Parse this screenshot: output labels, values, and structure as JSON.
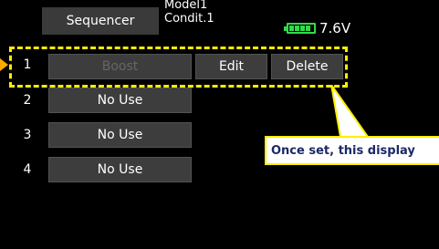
{
  "header": {
    "screen_title": "Sequencer",
    "model_name": "Model1",
    "condition": "Condit.1",
    "battery_voltage": "7.6V"
  },
  "rows": [
    {
      "number": "1",
      "sequence_label": "Boost",
      "sequence_enabled": false,
      "edit_label": "Edit",
      "delete_label": "Delete"
    },
    {
      "number": "2",
      "sequence_label": "No Use"
    },
    {
      "number": "3",
      "sequence_label": "No Use"
    },
    {
      "number": "4",
      "sequence_label": "No Use"
    }
  ],
  "annotation": {
    "callout_text": "Once set, this display",
    "highlight_color": "#ffee00",
    "pointer_color": "#ffaa00"
  },
  "colors": {
    "background": "#000000",
    "button_face": "#3d3d3d",
    "battery_green": "#2edc4a",
    "callout_text": "#1a2a66"
  }
}
